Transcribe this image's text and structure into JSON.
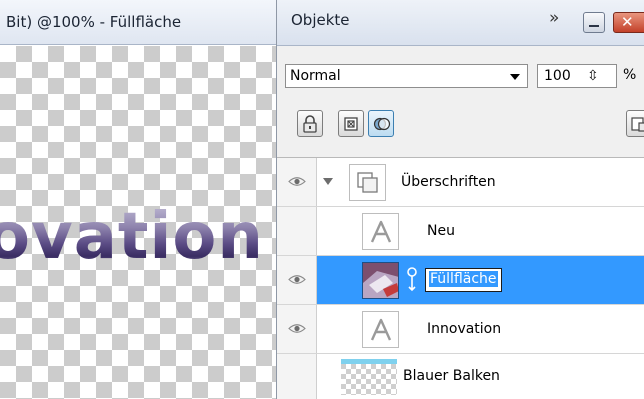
{
  "document": {
    "title": "Bit) @100% - Füllfläche",
    "canvas_text": "ovation"
  },
  "panel": {
    "title": "Objekte",
    "more_label": "»",
    "close_label": "✕",
    "blend_mode": "Normal",
    "opacity": "100",
    "opacity_stepper": "⇳",
    "opacity_unit": "%"
  },
  "layers": [
    {
      "name": "Überschriften",
      "visible": true,
      "thumb": "group-icon"
    },
    {
      "name": "Neu",
      "visible": false,
      "thumb": "text-icon"
    },
    {
      "name": "Füllfläche",
      "visible": true,
      "thumb": "image-thumb",
      "selected": true,
      "editing": true
    },
    {
      "name": "Innovation",
      "visible": true,
      "thumb": "text-icon"
    },
    {
      "name": "Blauer Balken",
      "visible": false,
      "thumb": "checker-thumb"
    }
  ],
  "colors": {
    "selection": "#3399ff",
    "canvas_text": "#6f6396",
    "bar": "#7fd1ee"
  }
}
